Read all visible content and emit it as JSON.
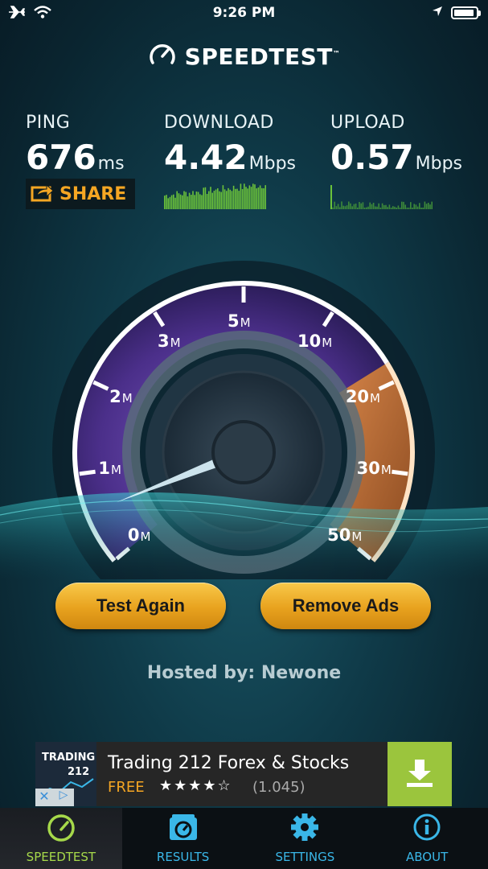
{
  "status_bar": {
    "time": "9:26 PM",
    "icons": [
      "airplane-icon",
      "wifi-icon",
      "location-arrow-icon",
      "battery-icon"
    ]
  },
  "logo": {
    "text": "SPEEDTEST",
    "mark": "™"
  },
  "results": {
    "ping": {
      "label": "PING",
      "value": "676",
      "unit": "ms"
    },
    "download": {
      "label": "DOWNLOAD",
      "value": "4.42",
      "unit": "Mbps"
    },
    "upload": {
      "label": "UPLOAD",
      "value": "0.57",
      "unit": "Mbps"
    }
  },
  "share": {
    "label": "SHARE"
  },
  "gauge": {
    "ticks": [
      {
        "num": "0",
        "unit": "M"
      },
      {
        "num": "1",
        "unit": "M"
      },
      {
        "num": "2",
        "unit": "M"
      },
      {
        "num": "3",
        "unit": "M"
      },
      {
        "num": "5",
        "unit": "M"
      },
      {
        "num": "10",
        "unit": "M"
      },
      {
        "num": "20",
        "unit": "M"
      },
      {
        "num": "30",
        "unit": "M"
      },
      {
        "num": "50",
        "unit": "M"
      }
    ],
    "needle_value_mbps": 0.57
  },
  "buttons": {
    "test_again": "Test Again",
    "remove_ads": "Remove Ads"
  },
  "hosted": "Hosted by: Newone",
  "ad": {
    "logo_line1": "TRADING",
    "logo_line2": "212",
    "title": "Trading 212 Forex & Stocks",
    "price": "FREE",
    "stars": "★★★★☆",
    "rating": 3.5,
    "rating_count": "(1.045)"
  },
  "tabs": [
    {
      "label": "SPEEDTEST",
      "icon": "speedometer-icon",
      "active": true
    },
    {
      "label": "RESULTS",
      "icon": "results-icon",
      "active": false
    },
    {
      "label": "SETTINGS",
      "icon": "gear-icon",
      "active": false
    },
    {
      "label": "ABOUT",
      "icon": "info-icon",
      "active": false
    }
  ],
  "colors": {
    "accent_orange": "#f5a623",
    "tab_blue": "#3ab7e8",
    "tab_active_green": "#a6d94a",
    "gauge_purple": "#5b3fa0",
    "spark_green": "#6ac23a"
  }
}
